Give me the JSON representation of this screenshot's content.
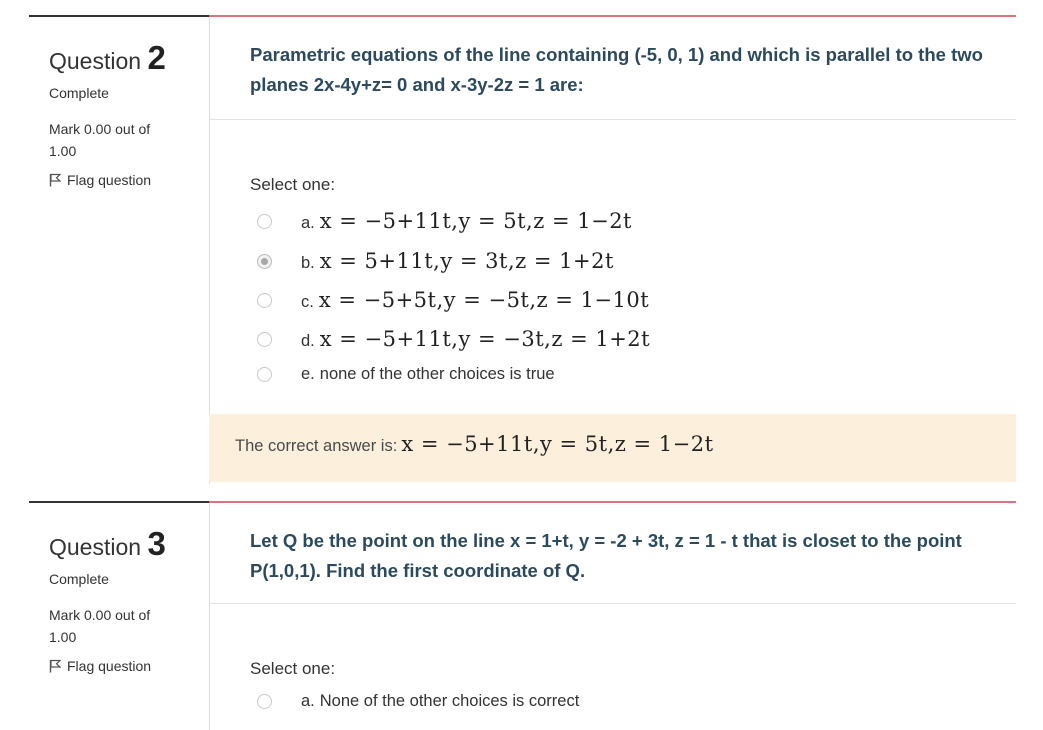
{
  "questions": [
    {
      "label": "Question",
      "number": "2",
      "state": "Complete",
      "grade": "Mark 0.00 out of 1.00",
      "flag": "Flag question",
      "text": "Parametric equations of the line containing (-5, 0, 1) and which is parallel to the two planes 2x-4y+z= 0 and x-3y-2z = 1 are:",
      "prompt": "Select one:",
      "options": [
        {
          "letter": "a.",
          "math": "x = −5+11t,y = 5t,z = 1−2t",
          "text": "",
          "checked": false
        },
        {
          "letter": "b.",
          "math": "x = 5+11t,y = 3t,z = 1+2t",
          "text": "",
          "checked": true
        },
        {
          "letter": "c.",
          "math": "x = −5+5t,y = −5t,z = 1−10t",
          "text": "",
          "checked": false
        },
        {
          "letter": "d.",
          "math": "x = −5+11t,y = −3t,z = 1+2t",
          "text": "",
          "checked": false
        },
        {
          "letter": "e.",
          "math": "",
          "text": "none of the other choices is true",
          "checked": false
        }
      ],
      "feedback_prefix": "The correct answer is:",
      "feedback_math": "x = −5+11t,y = 5t,z = 1−2t"
    },
    {
      "label": "Question",
      "number": "3",
      "state": "Complete",
      "grade": "Mark 0.00 out of 1.00",
      "flag": "Flag question",
      "text": "Let Q be the point on the line x = 1+t, y = -2 + 3t, z = 1 - t that is closet to the point P(1,0,1). Find the first coordinate of Q.",
      "prompt": "Select one:",
      "options": [
        {
          "letter": "a.",
          "math": "",
          "text": "None of the other choices is correct",
          "checked": false
        }
      ]
    }
  ],
  "colors": {
    "question_border": "#e0707e",
    "info_border": "#333333",
    "feedback_bg": "#fcefdc",
    "question_text": "#2c4a5e"
  },
  "icons": {
    "flag": "flag-icon"
  }
}
